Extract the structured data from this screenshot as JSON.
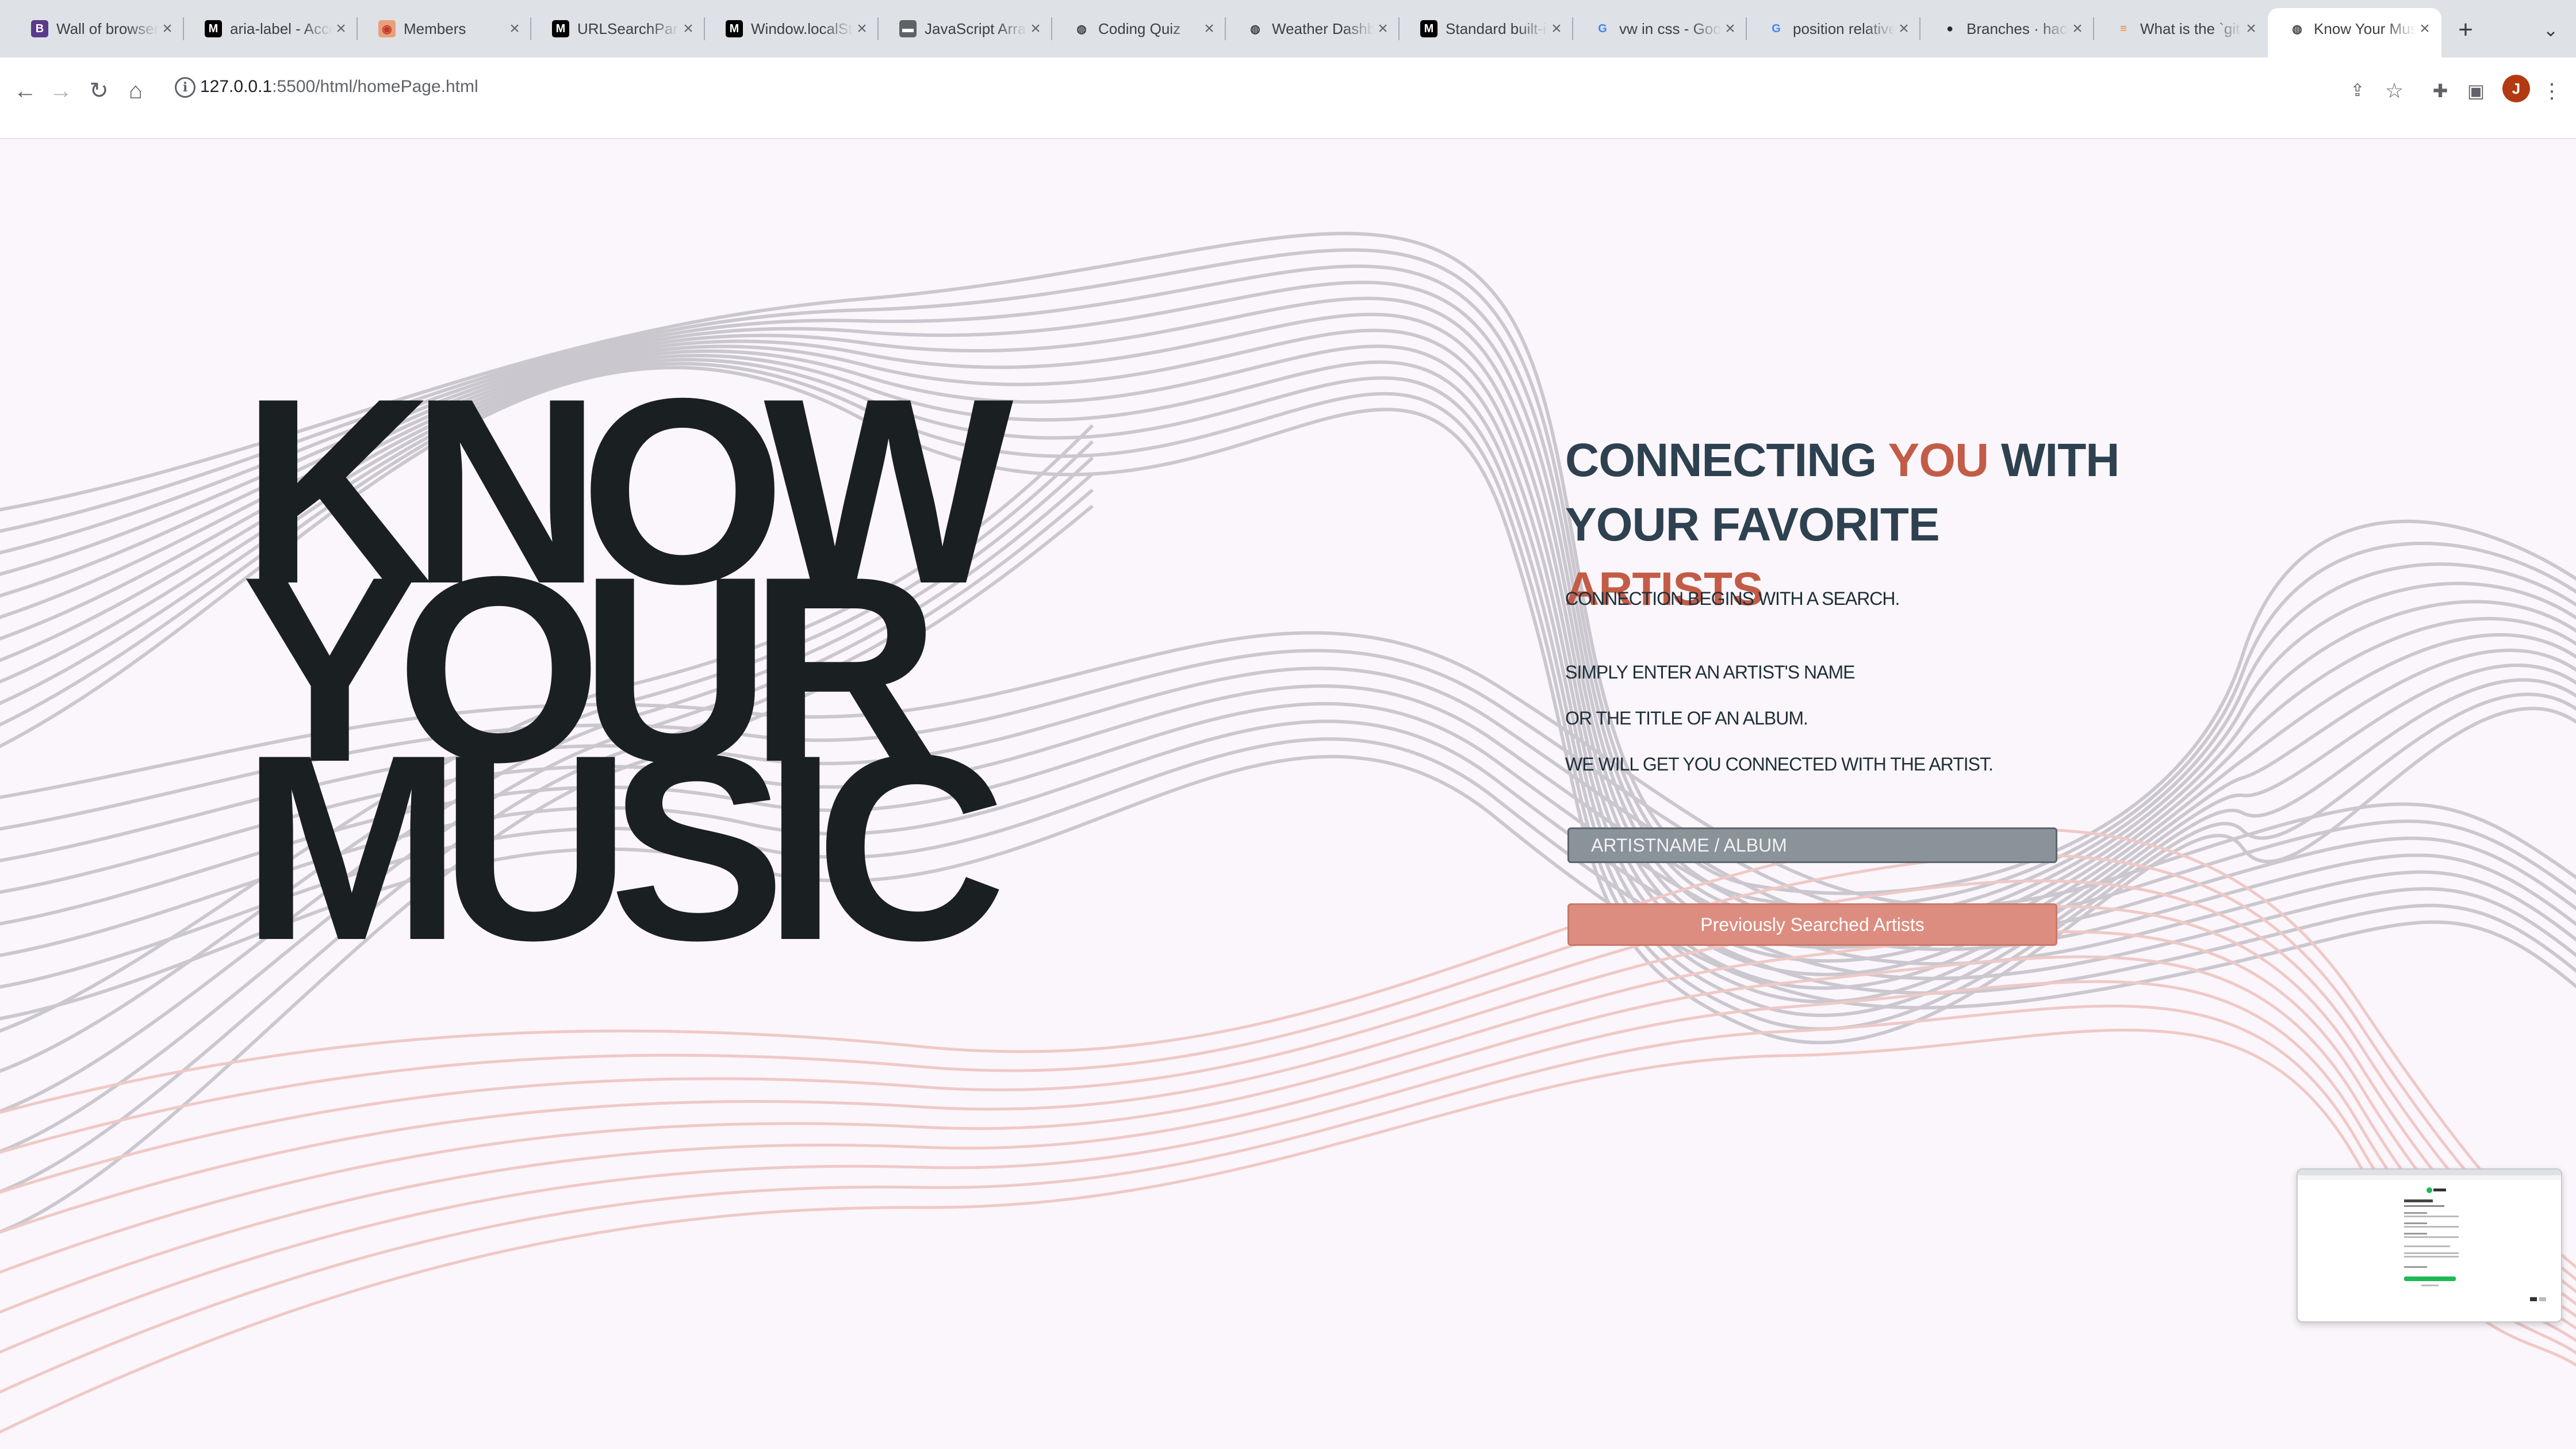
{
  "browser": {
    "tabs": [
      {
        "title": "Wall of browser bugs",
        "favicon": "bootstrap-icon",
        "fav_bg": "#5a3a8a",
        "fav_fg": "#ffffff",
        "fav_glyph": "B"
      },
      {
        "title": "aria-label - Accessibility",
        "favicon": "mdn-icon",
        "fav_bg": "#000000",
        "fav_fg": "#ffffff",
        "fav_glyph": "M"
      },
      {
        "title": "Members",
        "favicon": "palette-icon",
        "fav_bg": "#e9a07a",
        "fav_fg": "#c0392b",
        "fav_glyph": "◉"
      },
      {
        "title": "URLSearchParams",
        "favicon": "mdn-icon",
        "fav_bg": "#000000",
        "fav_fg": "#ffffff",
        "fav_glyph": "M"
      },
      {
        "title": "Window.localStorage",
        "favicon": "mdn-icon",
        "fav_bg": "#000000",
        "fav_fg": "#ffffff",
        "fav_glyph": "M"
      },
      {
        "title": "JavaScript Array",
        "favicon": "folder-icon",
        "fav_bg": "#5f6368",
        "fav_fg": "#ffffff",
        "fav_glyph": "▬"
      },
      {
        "title": "Coding Quiz",
        "favicon": "globe-icon",
        "fav_bg": "transparent",
        "fav_fg": "#3c4043",
        "fav_glyph": "◍"
      },
      {
        "title": "Weather Dashboard",
        "favicon": "globe-icon",
        "fav_bg": "transparent",
        "fav_fg": "#3c4043",
        "fav_glyph": "◍"
      },
      {
        "title": "Standard built-in objects",
        "favicon": "mdn-icon",
        "fav_bg": "#000000",
        "fav_fg": "#ffffff",
        "fav_glyph": "M"
      },
      {
        "title": "vw in css - Google Search",
        "favicon": "google-icon",
        "fav_bg": "transparent",
        "fav_fg": "#4285f4",
        "fav_glyph": "G"
      },
      {
        "title": "position relative",
        "favicon": "google-icon",
        "fav_bg": "transparent",
        "fav_fg": "#4285f4",
        "fav_glyph": "G"
      },
      {
        "title": "Branches · hackathon",
        "favicon": "github-icon",
        "fav_bg": "transparent",
        "fav_fg": "#24292f",
        "fav_glyph": "●"
      },
      {
        "title": "What is the `git`",
        "favicon": "stackoverflow-icon",
        "fav_bg": "transparent",
        "fav_fg": "#f48024",
        "fav_glyph": "≡"
      },
      {
        "title": "Know Your Music",
        "favicon": "globe-icon",
        "fav_bg": "transparent",
        "fav_fg": "#3c4043",
        "fav_glyph": "◍"
      }
    ],
    "active_tab_index": 13,
    "url_host": "127.0.0.1",
    "url_rest": ":5500/html/homePage.html",
    "avatar_letter": "J"
  },
  "page": {
    "hero_lines": [
      "KNOW",
      "YOUR",
      "MUSIC"
    ],
    "headline": {
      "line1_pre": "CONNECTING ",
      "line1_accent": "YOU",
      "line1_post": " WITH",
      "line2_pre": "YOUR FAVORITE ",
      "line2_accent": "ARTISTS"
    },
    "intro": "CONNECTION BEGINS WITH A SEARCH.",
    "instructions": [
      "SIMPLY ENTER AN ARTIST'S NAME",
      "OR THE TITLE OF AN ALBUM.",
      "WE WILL GET YOU CONNECTED WITH THE ARTIST."
    ],
    "search_placeholder": "ARTISTNAME / ALBUM",
    "search_value": "",
    "previous_button_label": "Previously Searched Artists"
  },
  "colors": {
    "background": "#fbf6fb",
    "hero_text": "#1a1f22",
    "headline": "#2d4150",
    "accent": "#c25c47",
    "search_bg": "#8a929a",
    "button_bg": "#dd8d80",
    "wave_gray": "#c9c7cf",
    "wave_pink": "#efc9c6"
  }
}
